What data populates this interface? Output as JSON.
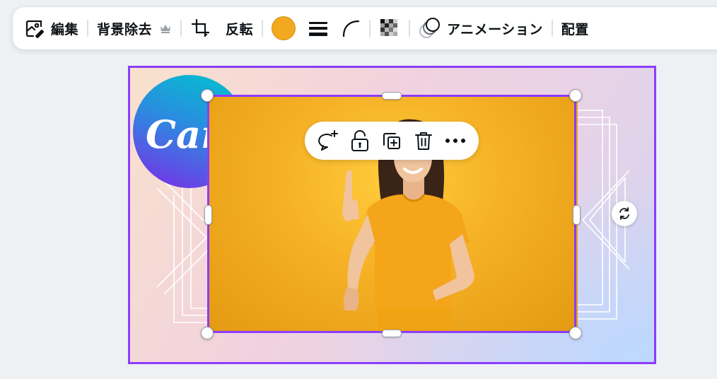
{
  "toolbar": {
    "edit_label": "編集",
    "bg_remove_label": "背景除去",
    "flip_label": "反転",
    "fill_color": "#f2a91f",
    "animate_label": "アニメーション",
    "arrange_label": "配置"
  },
  "canvas": {
    "logo_text": "Canva",
    "accent_color": "#8b3dff"
  },
  "icons": {
    "edit": "image-edit-icon",
    "premium": "crown-icon",
    "crop": "crop-icon",
    "border": "border-style-icon",
    "corner": "corner-rounding-icon",
    "transparency": "transparency-icon",
    "animate": "animate-icon",
    "comment": "comment-add-icon",
    "lock": "lock-icon",
    "duplicate": "duplicate-icon",
    "delete": "trash-icon",
    "more": "more-icon",
    "rotate": "rotate-icon"
  }
}
